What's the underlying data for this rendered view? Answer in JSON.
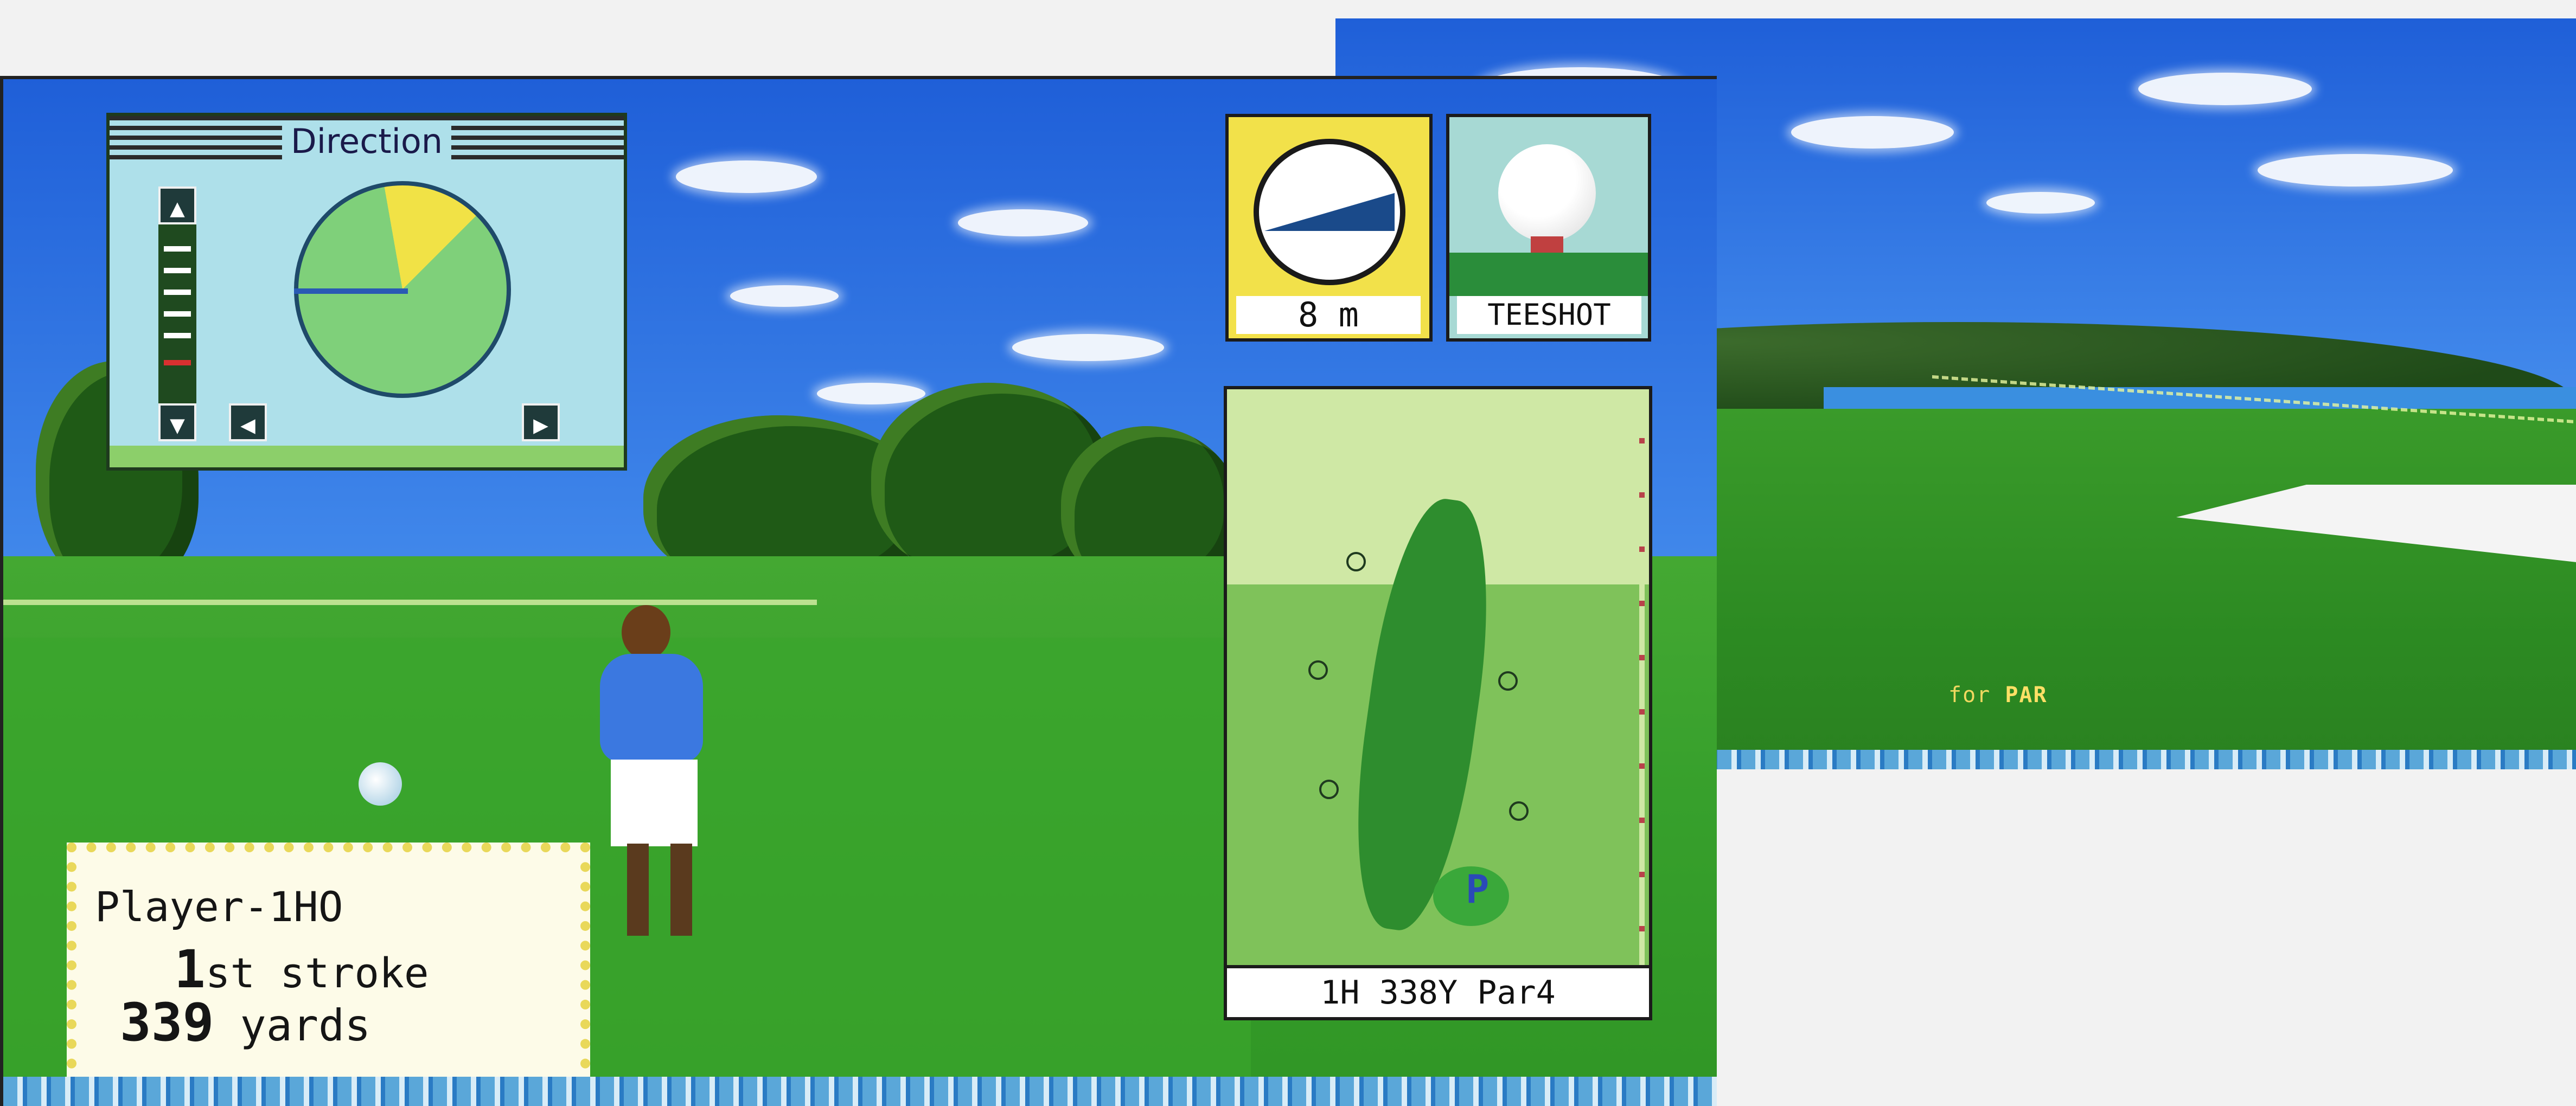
{
  "right_screen": {
    "status_text_prefix": "for",
    "status_text_highlight": "PAR"
  },
  "left_screen": {
    "direction_panel": {
      "title": "Direction",
      "up_button": "▲",
      "down_button": "▼",
      "left_button": "◀",
      "right_button": "▶"
    },
    "power_meter": {
      "distance": "8 m"
    },
    "shot_type": {
      "label": "TEESHOT"
    },
    "hole_map": {
      "info": "1H 338Y Par4",
      "pin_label": "P"
    },
    "player_info": {
      "name": "Player-1HO",
      "stroke_number": "1",
      "stroke_suffix": "st stroke",
      "yards_number": "339",
      "yards_suffix": " yards"
    }
  },
  "colors": {
    "sky": "#3f86ea",
    "grass": "#37a02c",
    "panel_bg": "#aee0ea",
    "power_bg": "#f2e14a",
    "player_box_border": "#e9d85a"
  }
}
